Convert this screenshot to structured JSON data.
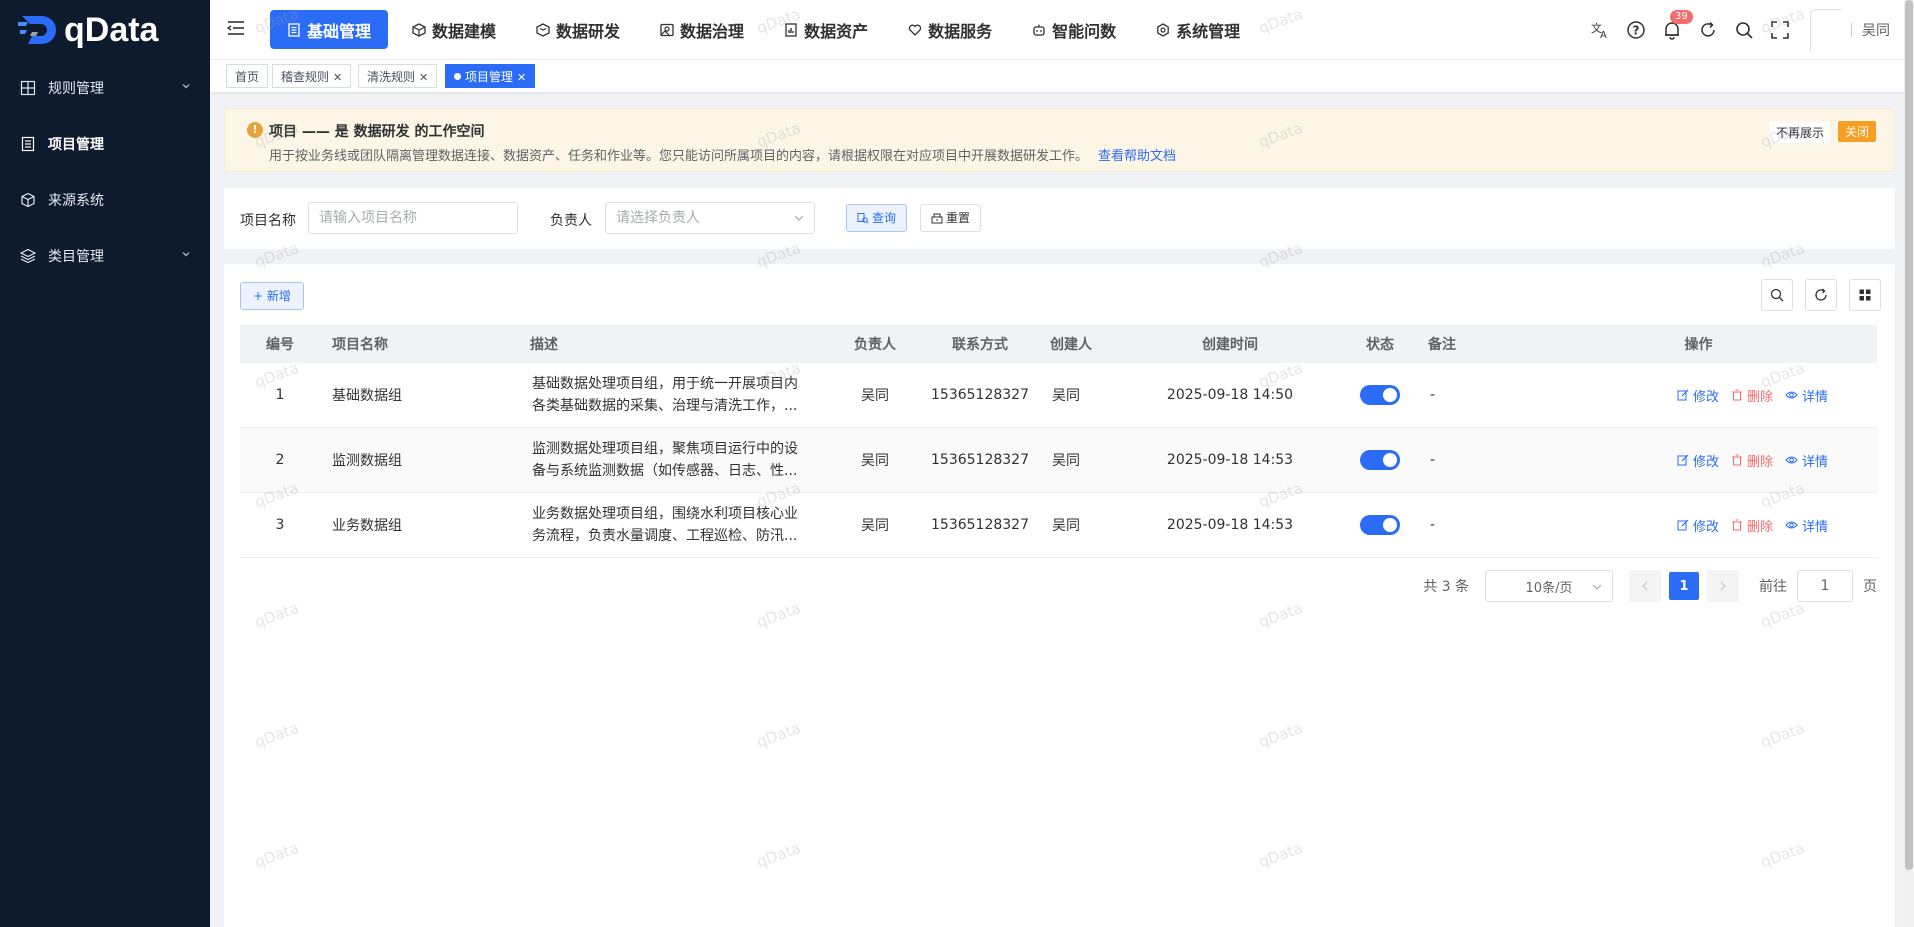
{
  "brand": {
    "name": "qData"
  },
  "sidebar": {
    "items": [
      {
        "label": "规则管理",
        "icon": "grid-icon",
        "has_children": true
      },
      {
        "label": "项目管理",
        "icon": "document-icon",
        "active": true
      },
      {
        "label": "来源系统",
        "icon": "cube-icon"
      },
      {
        "label": "类目管理",
        "icon": "layers-icon",
        "has_children": true
      }
    ]
  },
  "topnav": {
    "items": [
      {
        "label": "基础管理",
        "active": true
      },
      {
        "label": "数据建模"
      },
      {
        "label": "数据研发"
      },
      {
        "label": "数据治理"
      },
      {
        "label": "数据资产"
      },
      {
        "label": "数据服务"
      },
      {
        "label": "智能问数"
      },
      {
        "label": "系统管理"
      }
    ],
    "notification_count": "39",
    "username": "吴同"
  },
  "tabs": [
    {
      "label": "首页"
    },
    {
      "label": "稽查规则"
    },
    {
      "label": "清洗规则"
    },
    {
      "label": "项目管理",
      "active": true
    }
  ],
  "notice": {
    "title": "项目 —— 是 数据研发 的工作空间",
    "desc": "用于按业务线或团队隔离管理数据连接、数据资产、任务和作业等。您只能访问所属项目的内容，请根据权限在对应项目中开展数据研发工作。",
    "link": "查看帮助文档",
    "nomore": "不再展示",
    "close": "关闭"
  },
  "search": {
    "name_label": "项目名称",
    "name_placeholder": "请输入项目名称",
    "owner_label": "负责人",
    "owner_placeholder": "请选择负责人",
    "query": "查询",
    "reset": "重置"
  },
  "toolbar": {
    "add": "+ 新增"
  },
  "table": {
    "columns": [
      "编号",
      "项目名称",
      "描述",
      "负责人",
      "联系方式",
      "创建人",
      "创建时间",
      "状态",
      "备注",
      "操作"
    ],
    "rows": [
      {
        "id": "1",
        "name": "基础数据组",
        "desc1": "基础数据处理项目组，用于统一开展项目内",
        "desc2": "各类基础数据的采集、治理与清洗工作，...",
        "owner": "吴同",
        "phone": "15365128327",
        "creator": "吴同",
        "created": "2025-09-18 14:50",
        "status": true,
        "remark": "-"
      },
      {
        "id": "2",
        "name": "监测数据组",
        "desc1": "监测数据处理项目组，聚焦项目运行中的设",
        "desc2": "备与系统监测数据（如传感器、日志、性...",
        "owner": "吴同",
        "phone": "15365128327",
        "creator": "吴同",
        "created": "2025-09-18 14:53",
        "status": true,
        "remark": "-"
      },
      {
        "id": "3",
        "name": "业务数据组",
        "desc1": "业务数据处理项目组，围绕水利项目核心业",
        "desc2": "务流程，负责水量调度、工程巡检、防汛...",
        "owner": "吴同",
        "phone": "15365128327",
        "creator": "吴同",
        "created": "2025-09-18 14:53",
        "status": true,
        "remark": "-"
      }
    ],
    "actions": {
      "edit": "修改",
      "delete": "删除",
      "detail": "详情"
    }
  },
  "pagination": {
    "total": "共 3 条",
    "page_size": "10条/页",
    "current": "1",
    "goto_prefix": "前往",
    "goto_value": "1",
    "goto_suffix": "页"
  },
  "watermark": "qData",
  "colors": {
    "primary": "#2b6cf6",
    "sidebar": "#0e1a2e",
    "danger": "#f56c6c",
    "warning": "#f79f24"
  }
}
